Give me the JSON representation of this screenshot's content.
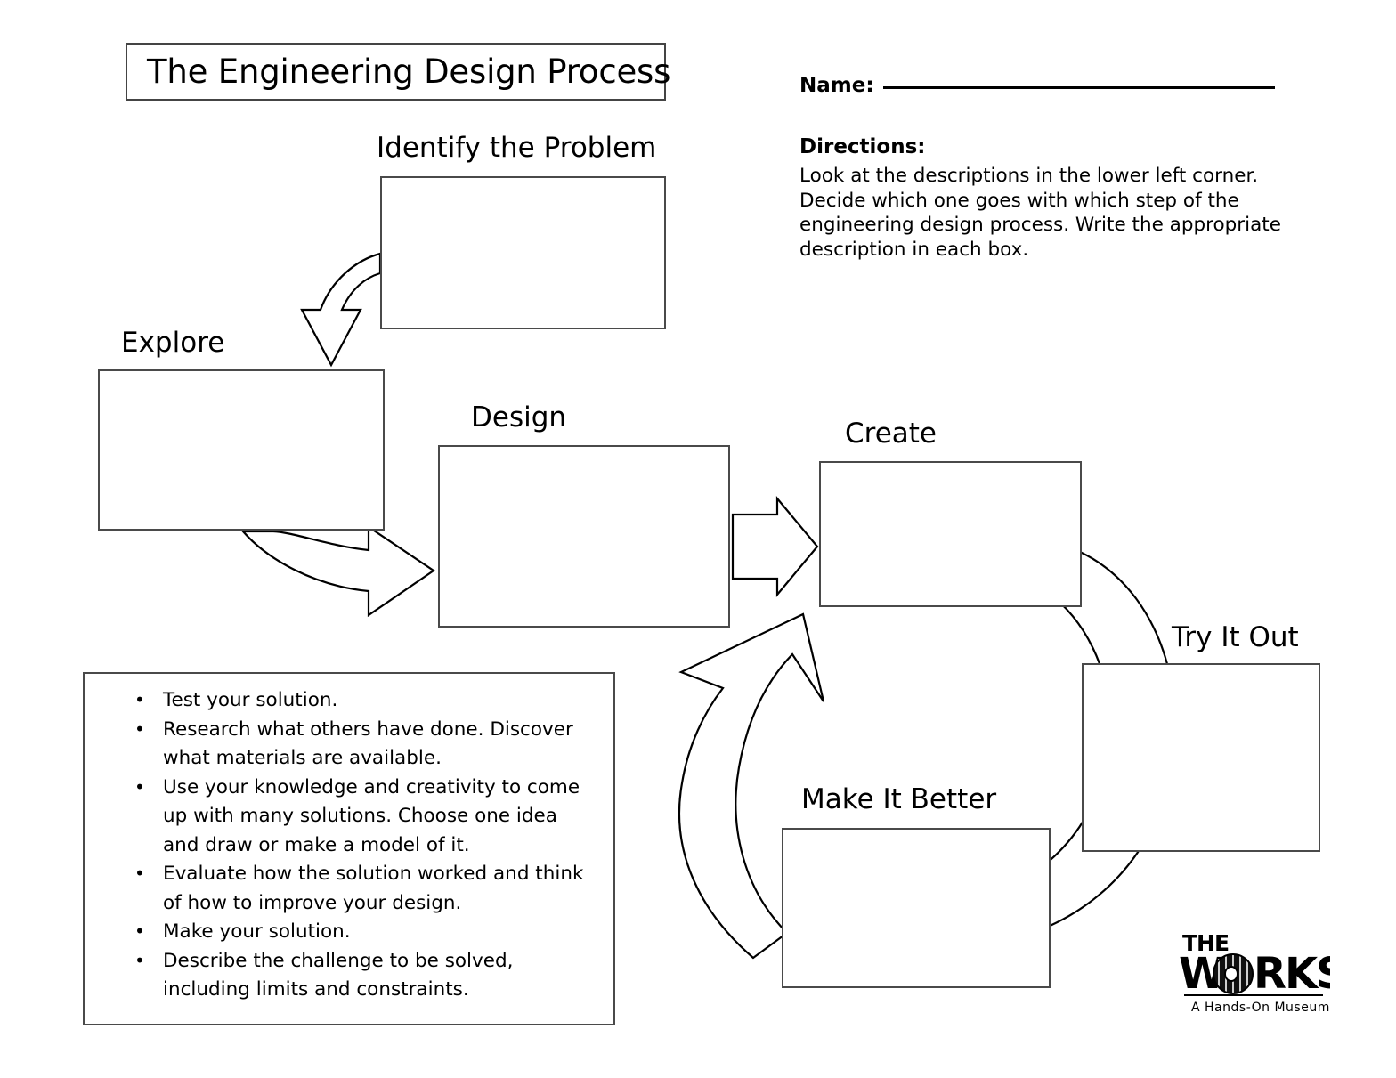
{
  "worksheet": {
    "title": "The Engineering Design Process",
    "name_label": "Name:",
    "directions_heading": "Directions:",
    "directions_body": "Look at the descriptions in the lower left corner.  Decide which one goes with which step of the engineering design process.  Write the appropriate description in each box."
  },
  "steps": [
    {
      "label": "Identify the Problem",
      "answer": ""
    },
    {
      "label": "Explore",
      "answer": ""
    },
    {
      "label": "Design",
      "answer": ""
    },
    {
      "label": "Create",
      "answer": ""
    },
    {
      "label": "Try It Out",
      "answer": ""
    },
    {
      "label": "Make It Better",
      "answer": ""
    }
  ],
  "descriptions": [
    "Test your solution.",
    "Research what others have done.  Discover what materials are available.",
    "Use your knowledge and creativity to come up with many solutions.  Choose one idea and draw or make a model of it.",
    "Evaluate how the solution worked and think of how to improve your design.",
    "Make your solution.",
    "Describe the challenge to be solved, including limits and constraints."
  ],
  "logo": {
    "line1": "THE",
    "line2": "W",
    "line3": "RKS",
    "tagline": "A Hands-On Museum"
  },
  "colors": {
    "ink": "#000000",
    "box_border": "#4a4a4a",
    "page_background": "#ffffff"
  }
}
